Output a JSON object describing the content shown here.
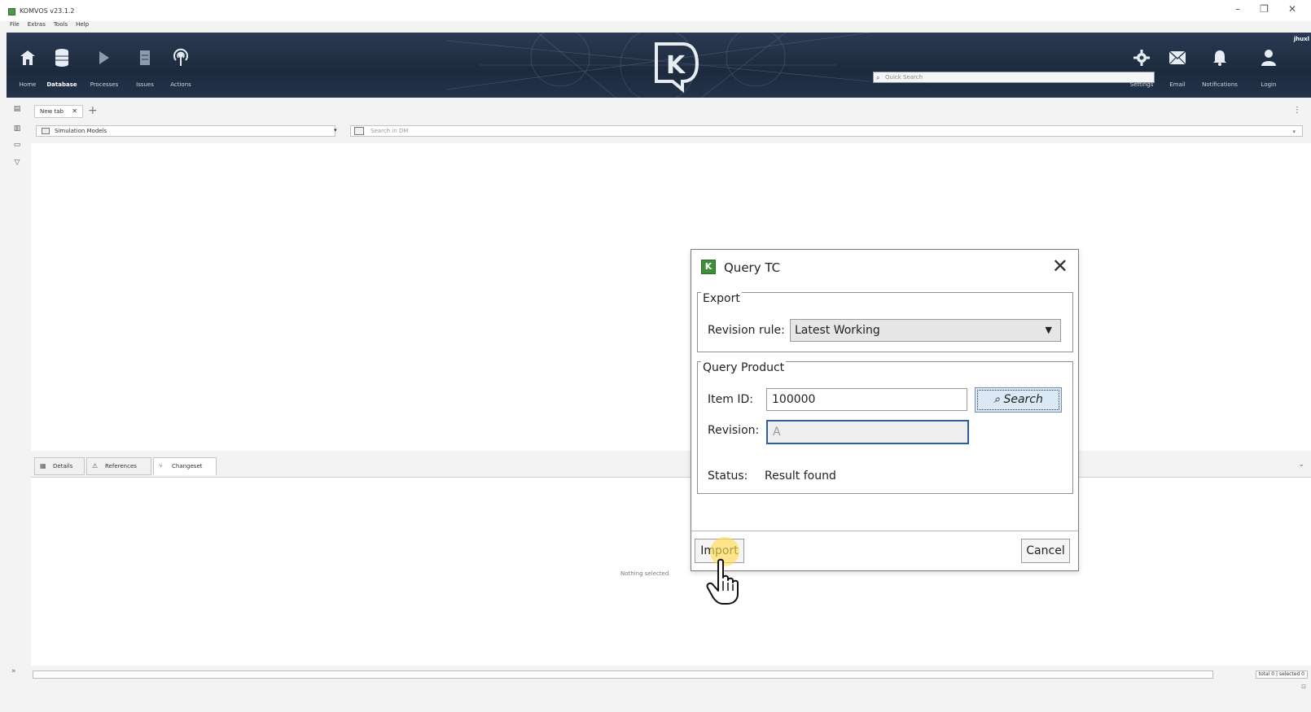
{
  "window": {
    "title": "KOMVOS v23.1.2",
    "controls": [
      "–",
      "❐",
      "✕"
    ]
  },
  "menubar": [
    "File",
    "Extras",
    "Tools",
    "Help"
  ],
  "ribbon": {
    "buttons": [
      {
        "label": "Home",
        "icon": "home-icon"
      },
      {
        "label": "Database",
        "icon": "database-icon",
        "active": true
      },
      {
        "label": "Processes",
        "icon": "play-icon"
      },
      {
        "label": "Issues",
        "icon": "issues-icon"
      },
      {
        "label": "Actions",
        "icon": "broadcast-icon"
      }
    ],
    "right_buttons": [
      {
        "label": "Settings",
        "icon": "gear-icon"
      },
      {
        "label": "Email",
        "icon": "email-icon"
      },
      {
        "label": "Notifications",
        "icon": "bell-icon"
      },
      {
        "label": "Login",
        "icon": "user-icon"
      }
    ],
    "quick_search_placeholder": "Quick Search",
    "user": "jhuxl"
  },
  "tabs": {
    "doc_tab_label": "New tab",
    "close": "✕",
    "add": "+"
  },
  "filter": {
    "model_select": "Simulation Models",
    "search_placeholder": "Search in DM"
  },
  "bottom_tabs": [
    {
      "label": "Details",
      "icon": "details-icon"
    },
    {
      "label": "References",
      "icon": "references-icon"
    },
    {
      "label": "Changeset",
      "icon": "changeset-icon",
      "active": true
    }
  ],
  "bottom_panel": {
    "empty_text": "Nothing selected"
  },
  "statusbar": {
    "counts": "total 0 | selected 0"
  },
  "dialog": {
    "title": "Query TC",
    "icon_letter": "K",
    "close": "✕",
    "export_group": {
      "legend": "Export",
      "revision_rule_label": "Revision rule:",
      "revision_rule_value": "Latest Working"
    },
    "query_group": {
      "legend": "Query Product",
      "item_id_label": "Item ID:",
      "item_id_value": "100000",
      "search_button": "Search",
      "revision_label": "Revision:",
      "revision_value": "A",
      "status_label": "Status:",
      "status_value": "Result found"
    },
    "import_button": "Import",
    "cancel_button": "Cancel"
  }
}
